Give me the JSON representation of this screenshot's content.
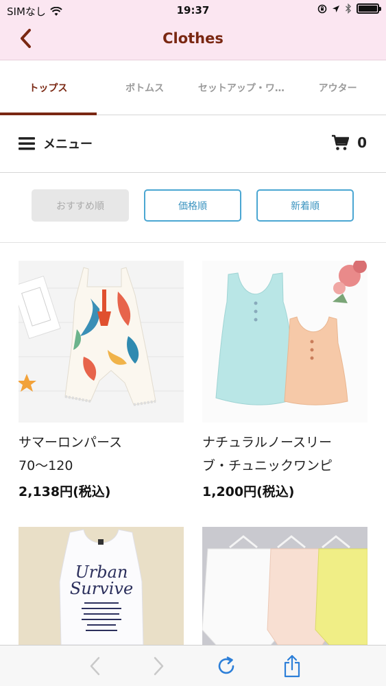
{
  "status_bar": {
    "carrier": "SIMなし",
    "time": "19:37",
    "battery_level": 1.0
  },
  "nav": {
    "title": "Clothes",
    "back_icon": "chevron-left-icon"
  },
  "tabs": [
    {
      "label": "トップス",
      "active": true
    },
    {
      "label": "ボトムス",
      "active": false
    },
    {
      "label": "セットアップ・ワ…",
      "active": false
    },
    {
      "label": "アウター",
      "active": false
    }
  ],
  "menu": {
    "label": "メニュー",
    "cart_count": "0"
  },
  "sort": {
    "recommended": "おすすめ順",
    "price": "価格順",
    "newest": "新着順"
  },
  "products": [
    {
      "name_line1": "サマーロンパース",
      "name_line2": "70〜120",
      "price": "2,138円(税込)"
    },
    {
      "name_line1": "ナチュラルノースリー",
      "name_line2": "ブ・チュニックワンピ",
      "price": "1,200円(税込)"
    },
    {
      "name_line1": "",
      "name_line2": "",
      "price": ""
    },
    {
      "name_line1": "",
      "name_line2": "",
      "price": ""
    }
  ],
  "shirt_print": {
    "line1": "Urban",
    "line2": "Survive"
  },
  "colors": {
    "header_bg": "#fbe6f1",
    "accent": "#7a2712",
    "sort_border": "#4aa6d2",
    "toolbar_icon": "#2d7fd8"
  }
}
